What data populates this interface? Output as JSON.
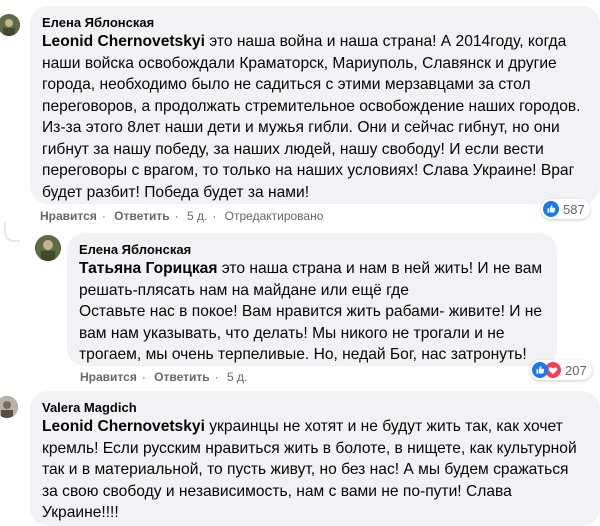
{
  "comments": [
    {
      "author": "Елена Яблонская",
      "mention": "Leonid Chernovetskyi",
      "text": " это наша война и наша страна! А 2014году, когда наши войска освобождали Краматорск, Мариуполь, Славянск и другие города, необходимо было не садиться с этими мерзавцами за стол переговоров, а продолжать стремительное освобождение наших городов. Из-за этого 8лет наши дети и мужья гибли. Они и сейчас гибнут, но они гибнут за нашу победу, за наших людей, нашу свободу! И если вести переговоры с врагом, то только на наших условиях! Слава Украине! Враг будет разбит! Победа будет за нами!",
      "like": "Нравится",
      "reply": "Ответить",
      "time": "5 д.",
      "edited": "Отредактировано",
      "reaction_count": "587",
      "reaction_icons": [
        "like-icon"
      ]
    },
    {
      "author": "Елена Яблонская",
      "mention": "Татьяна Горицкая",
      "text": " это наша страна и нам в ней жить! И не вам решать-плясать нам на майдане или ещё где\nОставьте нас в покое! Вам нравится жить рабами- живите! И не вам нам указывать, что делать! Мы никого не трогали и не трогаем, мы очень терпеливые. Но, недай Бог, нас затронуть!",
      "like": "Нравится",
      "reply": "Ответить",
      "time": "5 д.",
      "reaction_count": "207",
      "reaction_icons": [
        "like-icon",
        "love-icon"
      ]
    },
    {
      "author": "Valera Magdich",
      "mention": "Leonid Chernovetskyi",
      "text": " украинцы не хотят и не будут жить так, как хочет кремль! Если русским нравиться жить в болоте, в нищете, как культурной так и в материальной, то пусть живут, но без нас! А мы будем сражаться за свою свободу и независимость, нам с вами не по-пути! Слава Украине!!!!"
    }
  ],
  "colors": {
    "bubble": "#f0f2f5",
    "secondary_text": "#65676b",
    "like_blue": "#1877f2",
    "love_red": "#f33e58"
  }
}
